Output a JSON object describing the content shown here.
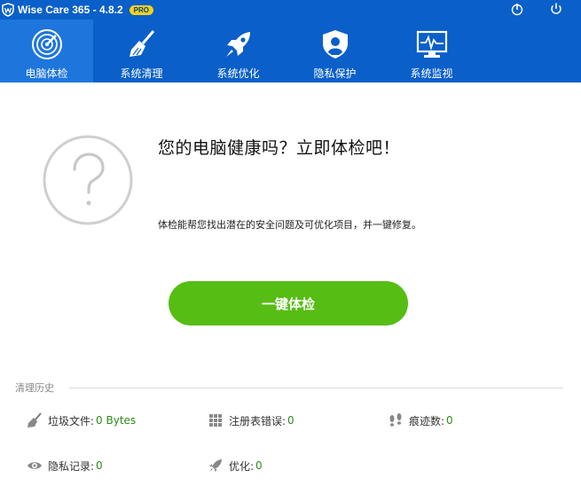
{
  "app": {
    "title": "Wise Care 365 - 4.8.2",
    "badge": "PRO",
    "accent_color": "#0a5fc9",
    "button_color": "#56bd14"
  },
  "nav": {
    "items": [
      {
        "label": "电脑体检",
        "icon": "radar-icon",
        "active": true
      },
      {
        "label": "系统清理",
        "icon": "broom-icon",
        "active": false
      },
      {
        "label": "系统优化",
        "icon": "rocket-icon",
        "active": false
      },
      {
        "label": "隐私保护",
        "icon": "shield-icon",
        "active": false
      },
      {
        "label": "系统监视",
        "icon": "monitor-icon",
        "active": false
      }
    ]
  },
  "main": {
    "headline": "您的电脑健康吗？立即体检吧！",
    "description": "体检能帮您找出潜在的安全问题及可优化项目，并一键修复。",
    "scan_button": "一键体检"
  },
  "history": {
    "title": "清理历史",
    "stats": [
      {
        "label": "垃圾文件:",
        "value": "0 Bytes",
        "icon": "broom-icon"
      },
      {
        "label": "注册表错误:",
        "value": "0",
        "icon": "grid-icon"
      },
      {
        "label": "痕迹数:",
        "value": "0",
        "icon": "footprints-icon"
      },
      {
        "label": "隐私记录:",
        "value": "0",
        "icon": "eye-icon"
      },
      {
        "label": "优化:",
        "value": "0",
        "icon": "rocket-icon"
      }
    ]
  }
}
